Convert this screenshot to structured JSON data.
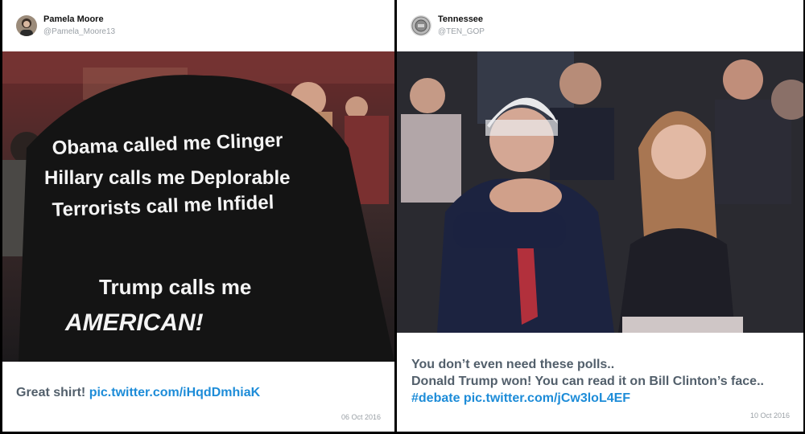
{
  "tweets": [
    {
      "name": "Pamela Moore",
      "handle": "@Pamela_Moore13",
      "photo_text": {
        "line1": "Obama called me Clinger",
        "line2": "Hillary calls me Deplorable",
        "line3": "Terrorists call me Infidel",
        "line4": "Trump calls me",
        "line5": "AMERICAN!"
      },
      "text": "Great shirt! ",
      "link": "pic.twitter.com/iHqdDmhiaK",
      "date": "06 Oct 2016"
    },
    {
      "name": "Tennessee",
      "handle": "@TEN_GOP",
      "text_line1": "You don’t even need these polls..",
      "text_line2": "Donald Trump won! You can read it on Bill Clinton’s face..",
      "hashtag": "#debate",
      "link": "pic.twitter.com/jCw3loL4EF",
      "date": "10 Oct 2016"
    }
  ],
  "colors": {
    "link": "#1d8cd8",
    "tweet_text": "#525f6b",
    "meta": "#9aa0a6"
  }
}
